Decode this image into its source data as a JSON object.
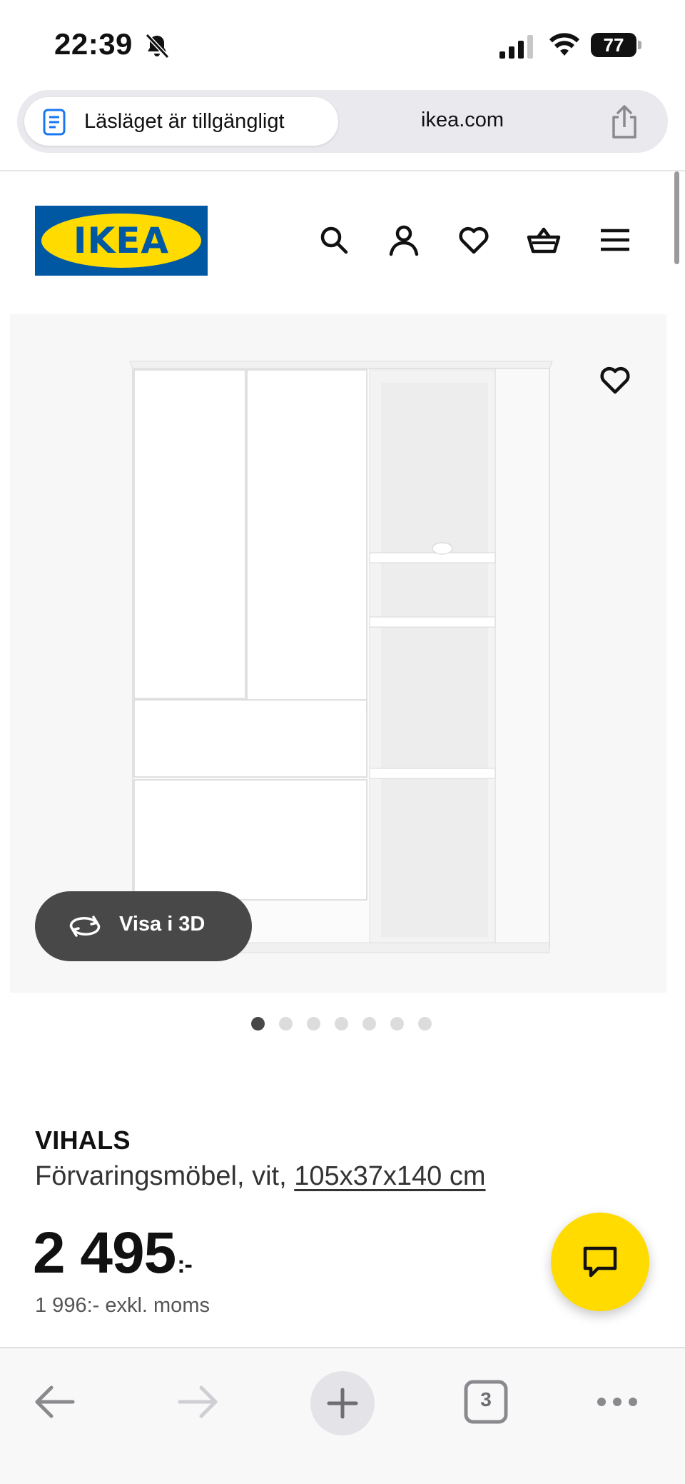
{
  "status_bar": {
    "time": "22:39",
    "battery": "77"
  },
  "browser": {
    "reader_label": "Läsläget är tillgängligt",
    "domain": "ikea.com",
    "tab_count": "3"
  },
  "brand": {
    "logo_text": "IKEA",
    "primary_blue": "#0058a3",
    "primary_yellow": "#ffdb00"
  },
  "header": {
    "icons": [
      "search-icon",
      "account-icon",
      "heart-icon",
      "basket-icon",
      "menu-icon"
    ]
  },
  "gallery": {
    "view_3d_label": "Visa i 3D",
    "image_count": 7,
    "active_index": 0
  },
  "product": {
    "name": "VIHALS",
    "description": "Förvaringsmöbel, vit, ",
    "dimensions": "105x37x140 cm",
    "price": "2 495",
    "price_suffix": ":-",
    "price_excl_vat": "1 996:- exkl. moms"
  }
}
